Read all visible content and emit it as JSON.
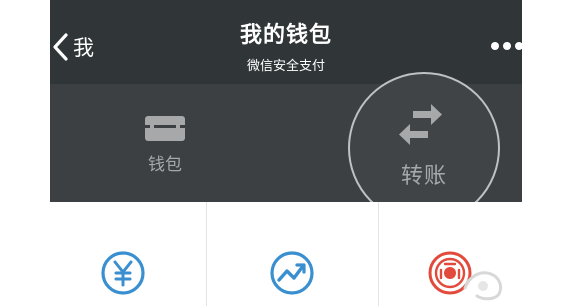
{
  "header": {
    "back_label": "我",
    "title": "我的钱包",
    "subtitle": "微信安全支付"
  },
  "tiles": {
    "wallet_label": "钱包",
    "transfer_label": "转账"
  },
  "icons": {
    "back": "chevron-left-icon",
    "more": "more-dots-icon",
    "wallet": "wallet-icon",
    "transfer": "transfer-arrows-icon",
    "service_1": "yuan-coin-icon",
    "service_2": "trend-chart-icon",
    "service_3": "red-seal-icon"
  },
  "colors": {
    "navbar": "#303538",
    "panel": "#3c4043",
    "tile_text": "#a6a8a9",
    "service_blue": "#3a8fd0",
    "service_red": "#e24b3b"
  }
}
